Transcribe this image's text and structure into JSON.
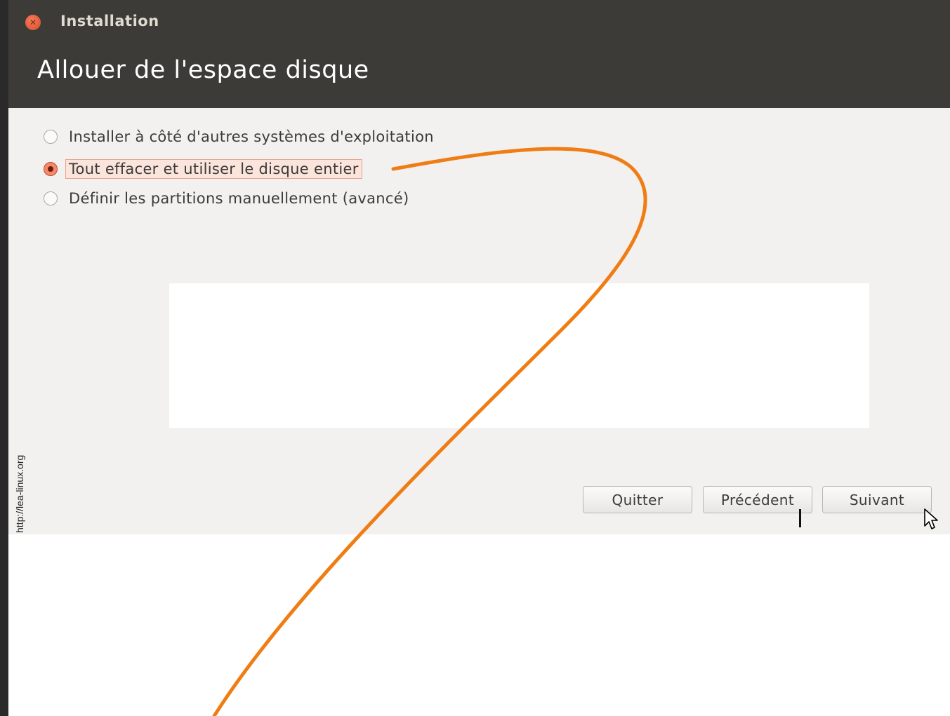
{
  "window": {
    "title": "Installation",
    "close_icon": "close-icon"
  },
  "header": {
    "title": "Allouer de l'espace disque"
  },
  "options": [
    {
      "label": "Installer à côté d'autres systèmes d'exploitation",
      "selected": false
    },
    {
      "label": "Tout effacer et utiliser le disque entier",
      "selected": true
    },
    {
      "label": "Définir les partitions manuellement (avancé)",
      "selected": false
    }
  ],
  "buttons": {
    "quit": "Quitter",
    "previous": "Précédent",
    "next": "Suivant"
  },
  "watermark": "http://lea-linux.org",
  "colors": {
    "titlebar": "#3c3b37",
    "accent": "#f08a6a",
    "annotation_curve": "#ef7d14"
  }
}
